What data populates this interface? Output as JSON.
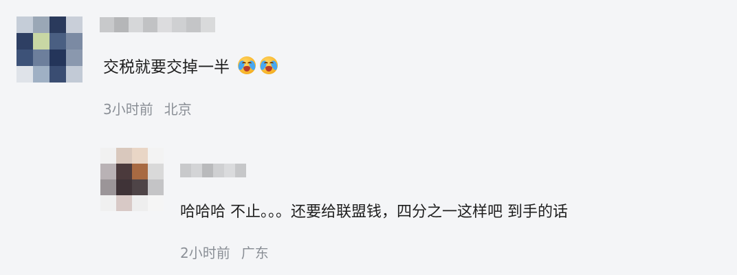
{
  "comments": [
    {
      "text": "交税就要交掉一半",
      "emojis": [
        "crying-laughing-emoji",
        "crying-laughing-emoji"
      ],
      "time": "3小时前",
      "location": "北京",
      "avatar_pixels": [
        "#c5cdd8",
        "#9aa7b6",
        "#2a3a5c",
        "#c9cfd9",
        "#2e3f63",
        "#c8d7a4",
        "#4a5f82",
        "#7b8aa3",
        "#3d5278",
        "#6d7f9c",
        "#24355a",
        "#8a98ae",
        "#dfe3e9",
        "#9fb0c4",
        "#3a4d72",
        "#c2cad6"
      ],
      "name_pixels": [
        "#c8c9cb",
        "#b5b6b8",
        "#d6d7d9",
        "#c1c2c4",
        "#dcdcde",
        "#cfd0d2",
        "#c4c5c7",
        "#d9dadb"
      ]
    },
    {
      "text": "哈哈哈 不止。。。还要给联盟钱，四分之一这样吧 到手的话",
      "emojis": [],
      "time": "2小时前",
      "location": "广东",
      "avatar_pixels": [
        "#f1f1f1",
        "#d9c8bd",
        "#e9d6c6",
        "#f3f3f3",
        "#b9b2b5",
        "#4b3a3c",
        "#a86a42",
        "#d9d9d9",
        "#9b9598",
        "#3f3337",
        "#4e4447",
        "#c4c4c6",
        "#f0f0f0",
        "#d8c9c6",
        "#eeeeee",
        "#f5f5f5"
      ],
      "name_pixels": [
        "#c8c9cb",
        "#d3d4d6",
        "#b9babc",
        "#cfd0d2",
        "#dadbdd",
        "#c6c7c9"
      ]
    }
  ]
}
